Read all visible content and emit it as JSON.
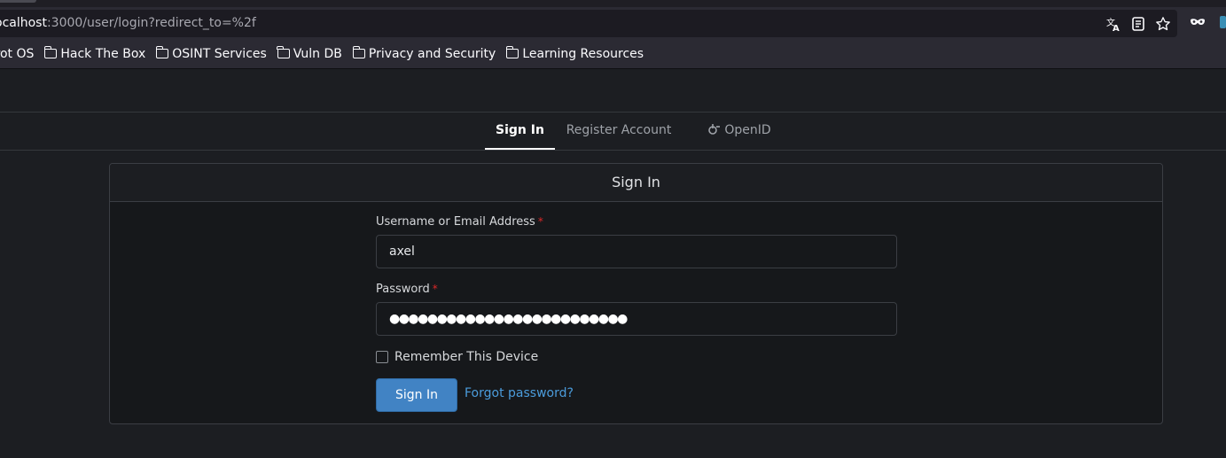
{
  "browser": {
    "url_host": "localhost",
    "url_host_visible": "ocalhost",
    "url_path": ":3000/user/login?redirect_to=%2f",
    "icons": [
      "translate-icon",
      "reader-mode-icon",
      "bookmark-star-icon",
      "private-mask-icon"
    ]
  },
  "bookmarks": [
    {
      "label": "rrot OS"
    },
    {
      "label": "Hack The Box"
    },
    {
      "label": "OSINT Services"
    },
    {
      "label": "Vuln DB"
    },
    {
      "label": "Privacy and Security"
    },
    {
      "label": "Learning Resources"
    }
  ],
  "auth_tabs": {
    "sign_in": "Sign In",
    "register": "Register Account",
    "openid": "OpenID"
  },
  "form": {
    "header": "Sign In",
    "username_label": "Username or Email Address",
    "username_value": "axel",
    "password_label": "Password",
    "password_dots": "●●●●●●●●●●●●●●●●●●●●●●●●●",
    "required_mark": "*",
    "remember_label": "Remember This Device",
    "remember_checked": false,
    "submit_label": "Sign In",
    "forgot_label": "Forgot password?"
  },
  "colors": {
    "primary_button": "#4183c4",
    "link": "#4b9cdc",
    "required": "#db2828"
  }
}
